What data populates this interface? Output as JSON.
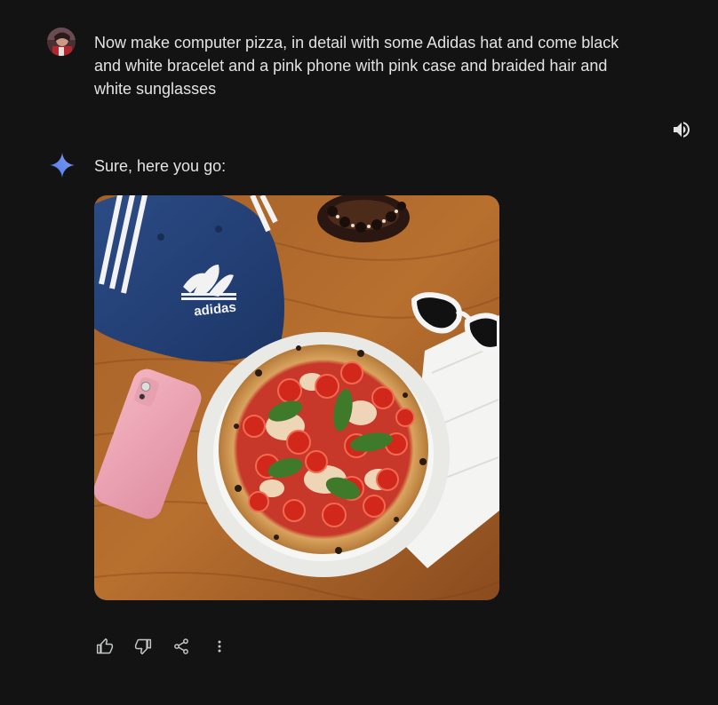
{
  "conversation": {
    "user_message": "Now make computer pizza, in detail with some Adidas hat and come black and white bracelet and a pink phone with pink case and braided hair and white sunglasses",
    "model_reply": "Sure, here you go:",
    "image_logo_text": "adidas"
  },
  "icons": {
    "avatar": "user-avatar",
    "speaker": "volume-icon",
    "model": "gemini-sparkle-icon",
    "like": "thumb-up-icon",
    "dislike": "thumb-down-icon",
    "share": "share-icon",
    "more": "more-vert-icon"
  },
  "colors": {
    "background": "#131314",
    "text": "#e3e3e3",
    "icon": "#c4c7c5"
  }
}
